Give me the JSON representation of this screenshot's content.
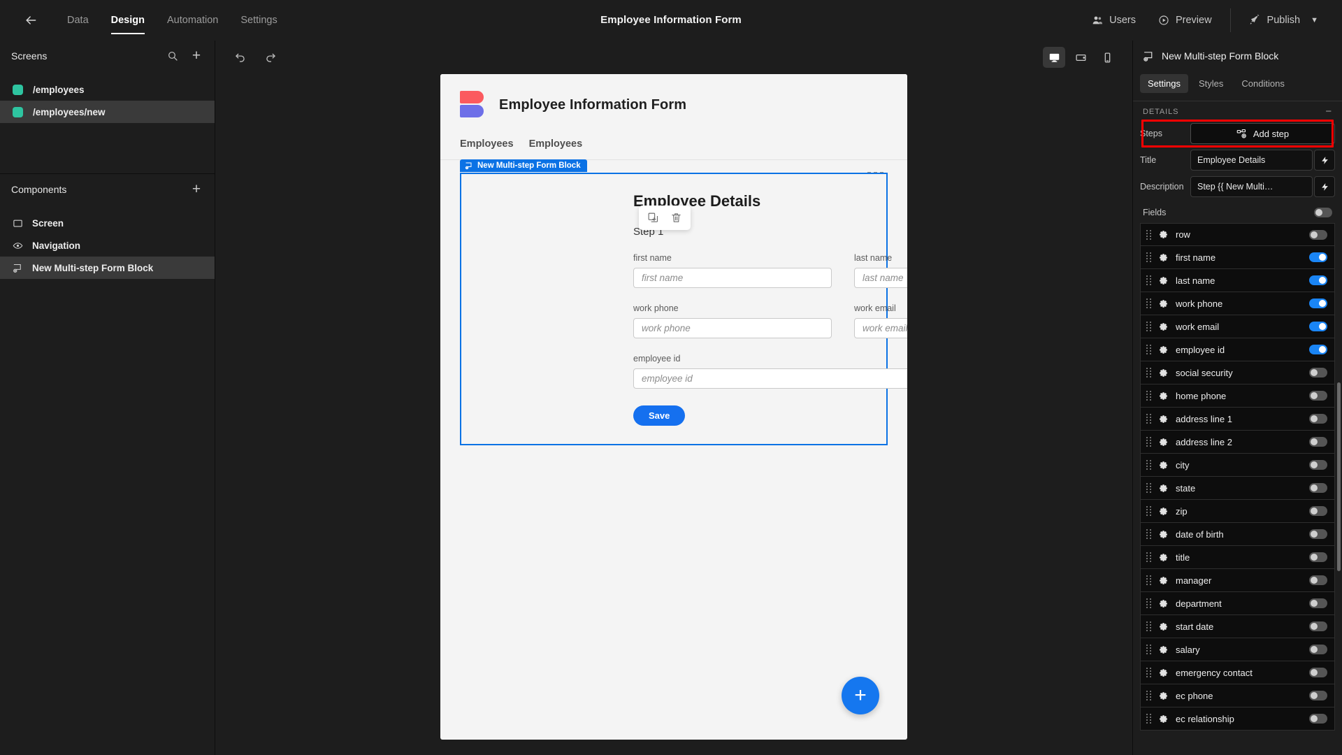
{
  "topbar": {
    "back_icon": "arrow-left-icon",
    "nav": [
      {
        "label": "Data",
        "active": false
      },
      {
        "label": "Design",
        "active": true
      },
      {
        "label": "Automation",
        "active": false
      },
      {
        "label": "Settings",
        "active": false
      }
    ],
    "app_title": "Employee Information Form",
    "users_label": "Users",
    "preview_label": "Preview",
    "publish_label": "Publish",
    "publish_chevron": "chevron-down-icon"
  },
  "left_panel": {
    "screens": {
      "title": "Screens",
      "search_icon": "search-icon",
      "add_icon": "plus-icon",
      "items": [
        {
          "label": "/employees",
          "color": "#2ec4a0",
          "selected": false
        },
        {
          "label": "/employees/new",
          "color": "#2ec4a0",
          "selected": true
        }
      ]
    },
    "components": {
      "title": "Components",
      "add_icon": "plus-icon",
      "items": [
        {
          "label": "Screen",
          "icon": "screen-icon",
          "selected": false
        },
        {
          "label": "Navigation",
          "icon": "eye-icon",
          "selected": false
        },
        {
          "label": "New Multi-step Form Block",
          "icon": "multistep-form-icon",
          "selected": true
        }
      ]
    }
  },
  "canvas_toolbar": {
    "undo_icon": "undo-icon",
    "redo_icon": "redo-icon",
    "devices": [
      {
        "name": "desktop",
        "icon": "desktop-icon",
        "active": true
      },
      {
        "name": "tablet",
        "icon": "tablet-icon",
        "active": false
      },
      {
        "name": "mobile",
        "icon": "mobile-icon",
        "active": false
      }
    ]
  },
  "canvas": {
    "brand_title": "Employee Information Form",
    "logo_colors": {
      "top": "#fb5a5f",
      "bottom": "#6d6fe8"
    },
    "nav_links": [
      "Employees",
      "Employees"
    ],
    "grid_icon": "grid-dots-icon",
    "float_toolbar": [
      {
        "name": "duplicate-icon"
      },
      {
        "name": "delete-icon"
      }
    ],
    "block_tag": "New Multi-step Form Block",
    "form": {
      "title": "Employee Details",
      "step": "Step 1",
      "rows": [
        [
          {
            "label": "first name",
            "placeholder": "first name",
            "value": ""
          },
          {
            "label": "last name",
            "placeholder": "last name",
            "value": ""
          }
        ],
        [
          {
            "label": "work phone",
            "placeholder": "work phone",
            "value": ""
          },
          {
            "label": "work email",
            "placeholder": "work email",
            "value": ""
          }
        ]
      ],
      "full_row": {
        "label": "employee id",
        "placeholder": "employee id",
        "value": ""
      },
      "save_label": "Save",
      "save_color": "#1570ef"
    },
    "fab_icon": "plus-icon"
  },
  "right_panel": {
    "header_title": "New Multi-step Form Block",
    "header_icon": "multistep-form-icon",
    "tabs": [
      {
        "label": "Settings",
        "active": true
      },
      {
        "label": "Styles",
        "active": false
      },
      {
        "label": "Conditions",
        "active": false
      }
    ],
    "section_title": "DETAILS",
    "collapse_icon": "minus-icon",
    "steps": {
      "label": "Steps",
      "button_label": "Add step",
      "button_icon": "add-step-icon",
      "highlighted": true,
      "highlight_color": "#ff0000"
    },
    "title_field": {
      "label": "Title",
      "value": "Employee Details",
      "binding_icon": "lightning-icon"
    },
    "description_field": {
      "label": "Description",
      "value": "Step {{ New Multi…",
      "binding_icon": "lightning-icon"
    },
    "fields_label": "Fields",
    "fields_master_toggle": false,
    "fields": [
      {
        "label": "row",
        "enabled": false
      },
      {
        "label": "first name",
        "enabled": true
      },
      {
        "label": "last name",
        "enabled": true
      },
      {
        "label": "work phone",
        "enabled": true
      },
      {
        "label": "work email",
        "enabled": true
      },
      {
        "label": "employee id",
        "enabled": true
      },
      {
        "label": "social security",
        "enabled": false
      },
      {
        "label": "home phone",
        "enabled": false
      },
      {
        "label": "address line 1",
        "enabled": false
      },
      {
        "label": "address line 2",
        "enabled": false
      },
      {
        "label": "city",
        "enabled": false
      },
      {
        "label": "state",
        "enabled": false
      },
      {
        "label": "zip",
        "enabled": false
      },
      {
        "label": "date of birth",
        "enabled": false
      },
      {
        "label": "title",
        "enabled": false
      },
      {
        "label": "manager",
        "enabled": false
      },
      {
        "label": "department",
        "enabled": false
      },
      {
        "label": "start date",
        "enabled": false
      },
      {
        "label": "salary",
        "enabled": false
      },
      {
        "label": "emergency contact",
        "enabled": false
      },
      {
        "label": "ec phone",
        "enabled": false
      },
      {
        "label": "ec relationship",
        "enabled": false
      }
    ]
  }
}
